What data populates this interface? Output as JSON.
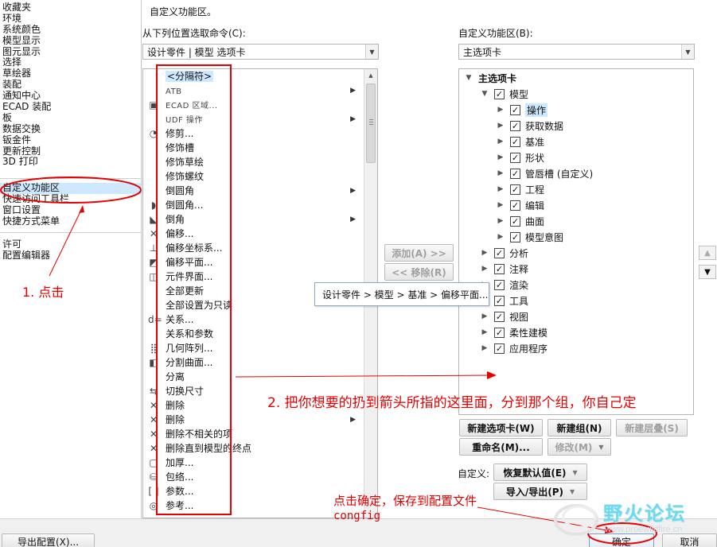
{
  "left_nav": {
    "group1": [
      "收藏夹",
      "环境",
      "系统颜色",
      "模型显示",
      "图元显示",
      "选择",
      "草绘器",
      "装配",
      "通知中心",
      "ECAD 装配",
      "板",
      "数据交换",
      "钣金件",
      "更新控制",
      "3D 打印"
    ],
    "group2": [
      "自定义功能区",
      "快速访问工具栏",
      "窗口设置",
      "快捷方式菜单"
    ],
    "group3": [
      "许可",
      "配置编辑器"
    ],
    "selected": "自定义功能区"
  },
  "main": {
    "heading": "自定义功能区。",
    "choose_from_label": "从下列位置选取命令(C):",
    "choose_from_value": "设计零件 | 模型 选项卡",
    "customize_label": "自定义功能区(B):",
    "customize_value": "主选项卡"
  },
  "commands": [
    {
      "label": "<分隔符>",
      "icon": "",
      "sub": false,
      "selected": true,
      "small": false
    },
    {
      "label": "ATB",
      "icon": "",
      "sub": true,
      "small": true
    },
    {
      "label": "ECAD 区域...",
      "icon": "ecad-icon",
      "glyph": "▣",
      "sub": false,
      "small": true
    },
    {
      "label": "UDF 操作",
      "icon": "",
      "sub": true,
      "small": true
    },
    {
      "label": "修剪...",
      "icon": "trim-icon",
      "glyph": "◔",
      "sub": false
    },
    {
      "label": "修饰槽",
      "icon": "",
      "sub": false
    },
    {
      "label": "修饰草绘",
      "icon": "",
      "sub": false
    },
    {
      "label": "修饰螺纹",
      "icon": "",
      "sub": false
    },
    {
      "label": "倒圆角",
      "icon": "",
      "sub": true
    },
    {
      "label": "倒圆角...",
      "icon": "round-icon",
      "glyph": "◗",
      "sub": false
    },
    {
      "label": "倒角",
      "icon": "chamfer-icon",
      "glyph": "◣",
      "sub": true
    },
    {
      "label": "偏移...",
      "icon": "offset-icon",
      "glyph": "✕",
      "sub": false
    },
    {
      "label": "偏移坐标系...",
      "icon": "csys-icon",
      "glyph": "⊥",
      "sub": false
    },
    {
      "label": "偏移平面...",
      "icon": "plane-icon",
      "glyph": "◩",
      "sub": false
    },
    {
      "label": "元件界面...",
      "icon": "interface-icon",
      "glyph": "◫",
      "sub": false
    },
    {
      "label": "全部更新",
      "icon": "",
      "sub": false
    },
    {
      "label": "全部设置为只读",
      "icon": "",
      "sub": false
    },
    {
      "label": "关系...",
      "icon": "relations-icon",
      "glyph": "d=",
      "sub": false
    },
    {
      "label": "关系和参数",
      "icon": "",
      "sub": false
    },
    {
      "label": "几何阵列...",
      "icon": "pattern-icon",
      "glyph": "⣿",
      "sub": false
    },
    {
      "label": "分割曲面...",
      "icon": "split-icon",
      "glyph": "◧",
      "sub": false
    },
    {
      "label": "分离",
      "icon": "",
      "sub": false
    },
    {
      "label": "切换尺寸",
      "icon": "dim-icon",
      "glyph": "⇆",
      "sub": false
    },
    {
      "label": "删除",
      "icon": "delete-icon",
      "glyph": "✕",
      "sub": false
    },
    {
      "label": "删除",
      "icon": "delete-icon",
      "glyph": "✕",
      "sub": true
    },
    {
      "label": "删除不相关的项",
      "icon": "delete-icon",
      "glyph": "✕",
      "sub": false
    },
    {
      "label": "删除直到模型的终点",
      "icon": "delete-icon",
      "glyph": "✕",
      "sub": false
    },
    {
      "label": "加厚...",
      "icon": "thicken-icon",
      "glyph": "▢",
      "sub": false
    },
    {
      "label": "包络...",
      "icon": "wrap-icon",
      "glyph": "⛁",
      "sub": false
    },
    {
      "label": "参数...",
      "icon": "param-icon",
      "glyph": "[ ]",
      "sub": false
    },
    {
      "label": "参考...",
      "icon": "ref-icon",
      "glyph": "◎",
      "sub": false
    }
  ],
  "middle": {
    "add_label": "添加(A) >>",
    "remove_label": "<< 移除(R)"
  },
  "tooltip": "设计零件 > 模型 > 基准 > 偏移平面...",
  "tree": {
    "root": "主选项卡",
    "model": "模型",
    "model_children": [
      "操作",
      "获取数据",
      "基准",
      "形状",
      "管唇槽 (自定义)",
      "工程",
      "编辑",
      "曲面",
      "模型意图"
    ],
    "others": [
      "分析",
      "注释",
      "渲染",
      "工具",
      "视图",
      "柔性建模",
      "应用程序"
    ],
    "selected": "操作"
  },
  "buttons": {
    "new_tab": "新建选项卡(W)",
    "new_group": "新建组(N)",
    "new_cascade": "新建层叠(S)",
    "rename": "重命名(M)...",
    "modify": "修改(M)",
    "customize_label": "自定义:",
    "reset": "恢复默认值(E)",
    "import_export": "导入/导出(P)",
    "export_config": "导出配置(X)...",
    "ok": "确定",
    "cancel": "取消"
  },
  "annotations": {
    "step1": "1. 点击",
    "step2": "2. 把你想要的扔到箭头所指的这里面，分到那个组，你自己定",
    "step3_line1": "点击确定，保存到配置文件",
    "step3_line2": "congfig"
  },
  "watermark": {
    "text": "野火论坛",
    "url": "www.proewildfire.cn"
  },
  "colors": {
    "annotation_red": "#e60000",
    "selection_blue": "#cde8ff",
    "watermark_cyan": "#6fd7ee"
  }
}
